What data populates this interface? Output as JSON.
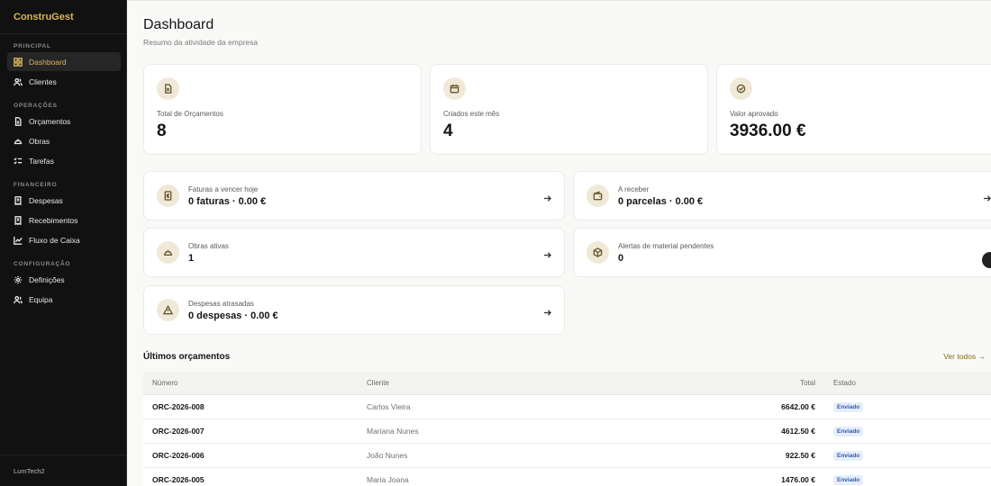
{
  "sidebar": {
    "brand": "ConstruGest",
    "sections": {
      "principal": "PRINCIPAL",
      "operacoes": "OPERAÇÕES",
      "financeiro": "FINANCEIRO",
      "configuracao": "CONFIGURAÇÃO"
    },
    "items": {
      "dashboard": {
        "label": "Dashboard",
        "icon": "grid-icon"
      },
      "clientes": {
        "label": "Clientes",
        "icon": "users-icon"
      },
      "orcamentos": {
        "label": "Orçamentos",
        "icon": "file-icon"
      },
      "obras": {
        "label": "Obras",
        "icon": "helmet-icon"
      },
      "tarefas": {
        "label": "Tarefas",
        "icon": "checklist-icon"
      },
      "despesas": {
        "label": "Despesas",
        "icon": "receipt-icon"
      },
      "recebimentos": {
        "label": "Recebimentos",
        "icon": "receipt-icon"
      },
      "fluxo": {
        "label": "Fluxo de Caixa",
        "icon": "chart-icon"
      },
      "definicoes": {
        "label": "Definições",
        "icon": "gear-icon"
      },
      "equipa": {
        "label": "Equipa",
        "icon": "team-icon"
      }
    },
    "footer": "LumTech2"
  },
  "colors": {
    "accent": "#d9b65a",
    "sidebar_bg": "#111111",
    "badge_text": "#2d5bb8",
    "badge_bg": "#e6eefb"
  },
  "header": {
    "title": "Dashboard",
    "subtitle": "Resumo da atividade da empresa"
  },
  "stats": [
    {
      "label": "Total de Orçamentos",
      "value": "8",
      "icon": "document-icon"
    },
    {
      "label": "Criados este mês",
      "value": "4",
      "icon": "calendar-icon"
    },
    {
      "label": "Valor aprovado",
      "value": "3936.00 €",
      "icon": "check-circle-icon"
    }
  ],
  "rows": [
    {
      "label": "Faturas a vencer hoje",
      "value": "0 faturas · 0.00 €",
      "icon": "invoice-icon"
    },
    {
      "label": "A receber",
      "value": "0 parcelas · 0.00 €",
      "icon": "wallet-icon"
    },
    {
      "label": "Obras ativas",
      "value": "1",
      "icon": "helmet-icon"
    },
    {
      "label": "Alertas de material pendentes",
      "value": "0",
      "icon": "package-icon"
    },
    {
      "label": "Despesas atrasadas",
      "value": "0 despesas · 0.00 €",
      "icon": "warning-icon"
    }
  ],
  "quotes": {
    "title": "Últimos orçamentos",
    "see_all": "Ver todos →",
    "columns": {
      "numero": "Número",
      "cliente": "Cliente",
      "total": "Total",
      "estado": "Estado"
    },
    "rows": [
      {
        "numero": "ORC-2026-008",
        "cliente": "Carlos Vieira",
        "total": "6642.00 €",
        "estado": "Enviado"
      },
      {
        "numero": "ORC-2026-007",
        "cliente": "Mariana Nunes",
        "total": "4612.50 €",
        "estado": "Enviado"
      },
      {
        "numero": "ORC-2026-006",
        "cliente": "João Nunes",
        "total": "922.50 €",
        "estado": "Enviado"
      },
      {
        "numero": "ORC-2026-005",
        "cliente": "Maria Joana",
        "total": "1476.00 €",
        "estado": "Enviado"
      }
    ]
  }
}
